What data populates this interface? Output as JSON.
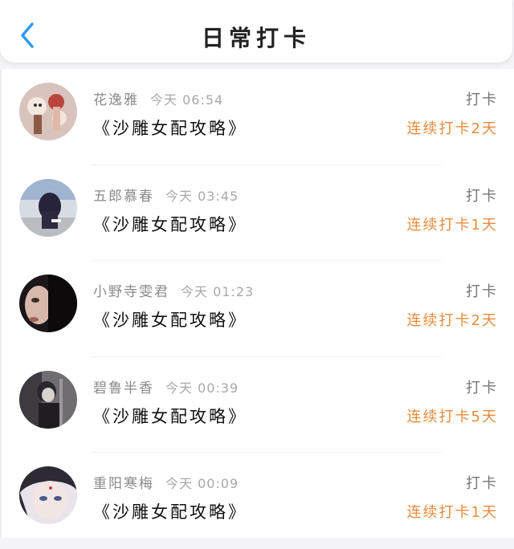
{
  "header": {
    "title": "日常打卡",
    "back_icon": "chevron-left-icon",
    "accent_color": "#2f9bf0"
  },
  "colors": {
    "streak": "#e88a3c"
  },
  "entries": [
    {
      "user": "花逸雅",
      "time": "今天 06:54",
      "book": "《沙雕女配攻略》",
      "action": "打卡",
      "streak": "连续打卡2天",
      "avatar": "avatar-dolls"
    },
    {
      "user": "五郎慕春",
      "time": "今天 03:45",
      "book": "《沙雕女配攻略》",
      "action": "打卡",
      "streak": "连续打卡1天",
      "avatar": "avatar-girl-back"
    },
    {
      "user": "小野寺雯君",
      "time": "今天 01:23",
      "book": "《沙雕女配攻略》",
      "action": "打卡",
      "streak": "连续打卡2天",
      "avatar": "avatar-face-closeup"
    },
    {
      "user": "碧鲁半香",
      "time": "今天 00:39",
      "book": "《沙雕女配攻略》",
      "action": "打卡",
      "streak": "连续打卡5天",
      "avatar": "avatar-anime-boy"
    },
    {
      "user": "重阳寒梅",
      "time": "今天 00:09",
      "book": "《沙雕女配攻略》",
      "action": "打卡",
      "streak": "连续打卡1天",
      "avatar": "avatar-anime-girl"
    }
  ]
}
